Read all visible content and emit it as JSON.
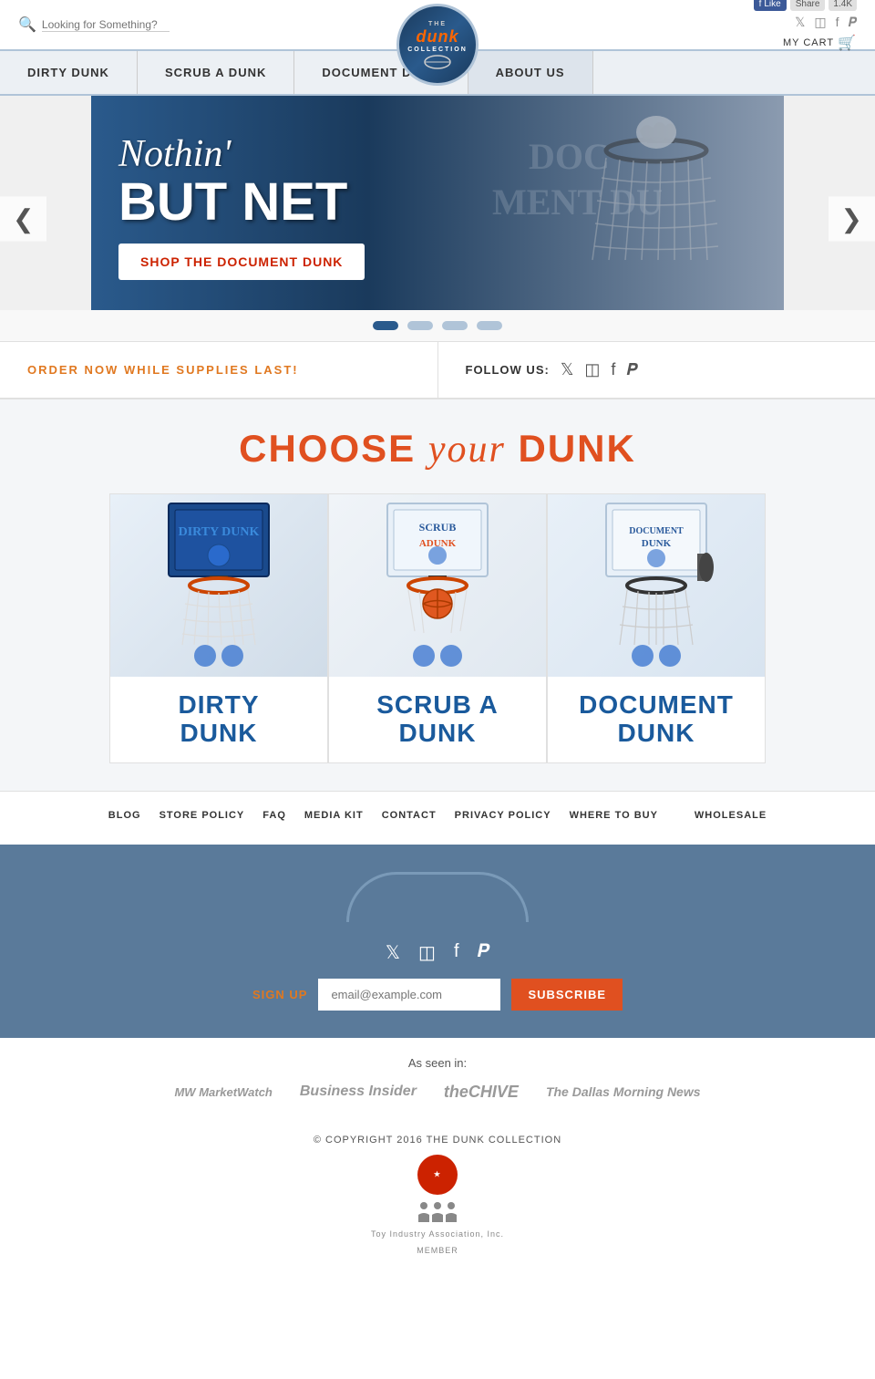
{
  "header": {
    "search_placeholder": "Looking for Something?",
    "cart_label": "MY CART",
    "fb_like": "Like",
    "fb_share": "Share",
    "fb_count": "1.4K"
  },
  "nav": {
    "items": [
      {
        "label": "DIRTY DUNK",
        "id": "dirty-dunk"
      },
      {
        "label": "SCRUB A DUNK",
        "id": "scrub-a-dunk"
      },
      {
        "label": "DOCUMENT DUNK",
        "id": "document-dunk"
      },
      {
        "label": "ABOUT US",
        "id": "about-us"
      }
    ]
  },
  "hero": {
    "tagline_italic": "Nothin'",
    "tagline_bold": "BUT NET",
    "cta_label": "SHOP THE DOCUMENT DUNK",
    "prev_arrow": "❮",
    "next_arrow": "❯"
  },
  "order_bar": {
    "order_text": "ORDER NOW WHILE SUPPLIES LAST!",
    "follow_label": "FOLLOW US:"
  },
  "choose": {
    "title_bold1": "CHOOSE",
    "title_italic": "your",
    "title_bold2": "DUNK",
    "products": [
      {
        "name": "DIRTY\nDUNK",
        "id": "dirty-dunk"
      },
      {
        "name": "SCRUB A\nDUNK",
        "id": "scrub-a-dunk"
      },
      {
        "name": "DOCUMENT\nDUNK",
        "id": "document-dunk"
      }
    ]
  },
  "footer_links": {
    "items": [
      {
        "label": "BLOG"
      },
      {
        "label": "STORE POLICY"
      },
      {
        "label": "FAQ"
      },
      {
        "label": "MEDIA KIT"
      },
      {
        "label": "CONTACT"
      },
      {
        "label": "PRIVACY POLICY"
      },
      {
        "label": "WHERE TO BUY"
      },
      {
        "label": "WHOLESALE"
      }
    ]
  },
  "footer": {
    "signup_label": "SIGN UP",
    "email_placeholder": "email@example.com",
    "subscribe_label": "SUBSCRIBE",
    "as_seen_label": "As seen in:",
    "press": [
      {
        "label": "MarketWatch",
        "class": "market-watch"
      },
      {
        "label": "Business Insider",
        "class": "business-insider"
      },
      {
        "label": "theChive",
        "class": "the-chive"
      },
      {
        "label": "The Dallas Morning News",
        "class": "dallas"
      }
    ],
    "copyright": "© COPYRIGHT 2016 THE DUNK COLLECTION",
    "toy_label": "Toy Industry Association, Inc.",
    "toy_member": "MEMBER"
  }
}
